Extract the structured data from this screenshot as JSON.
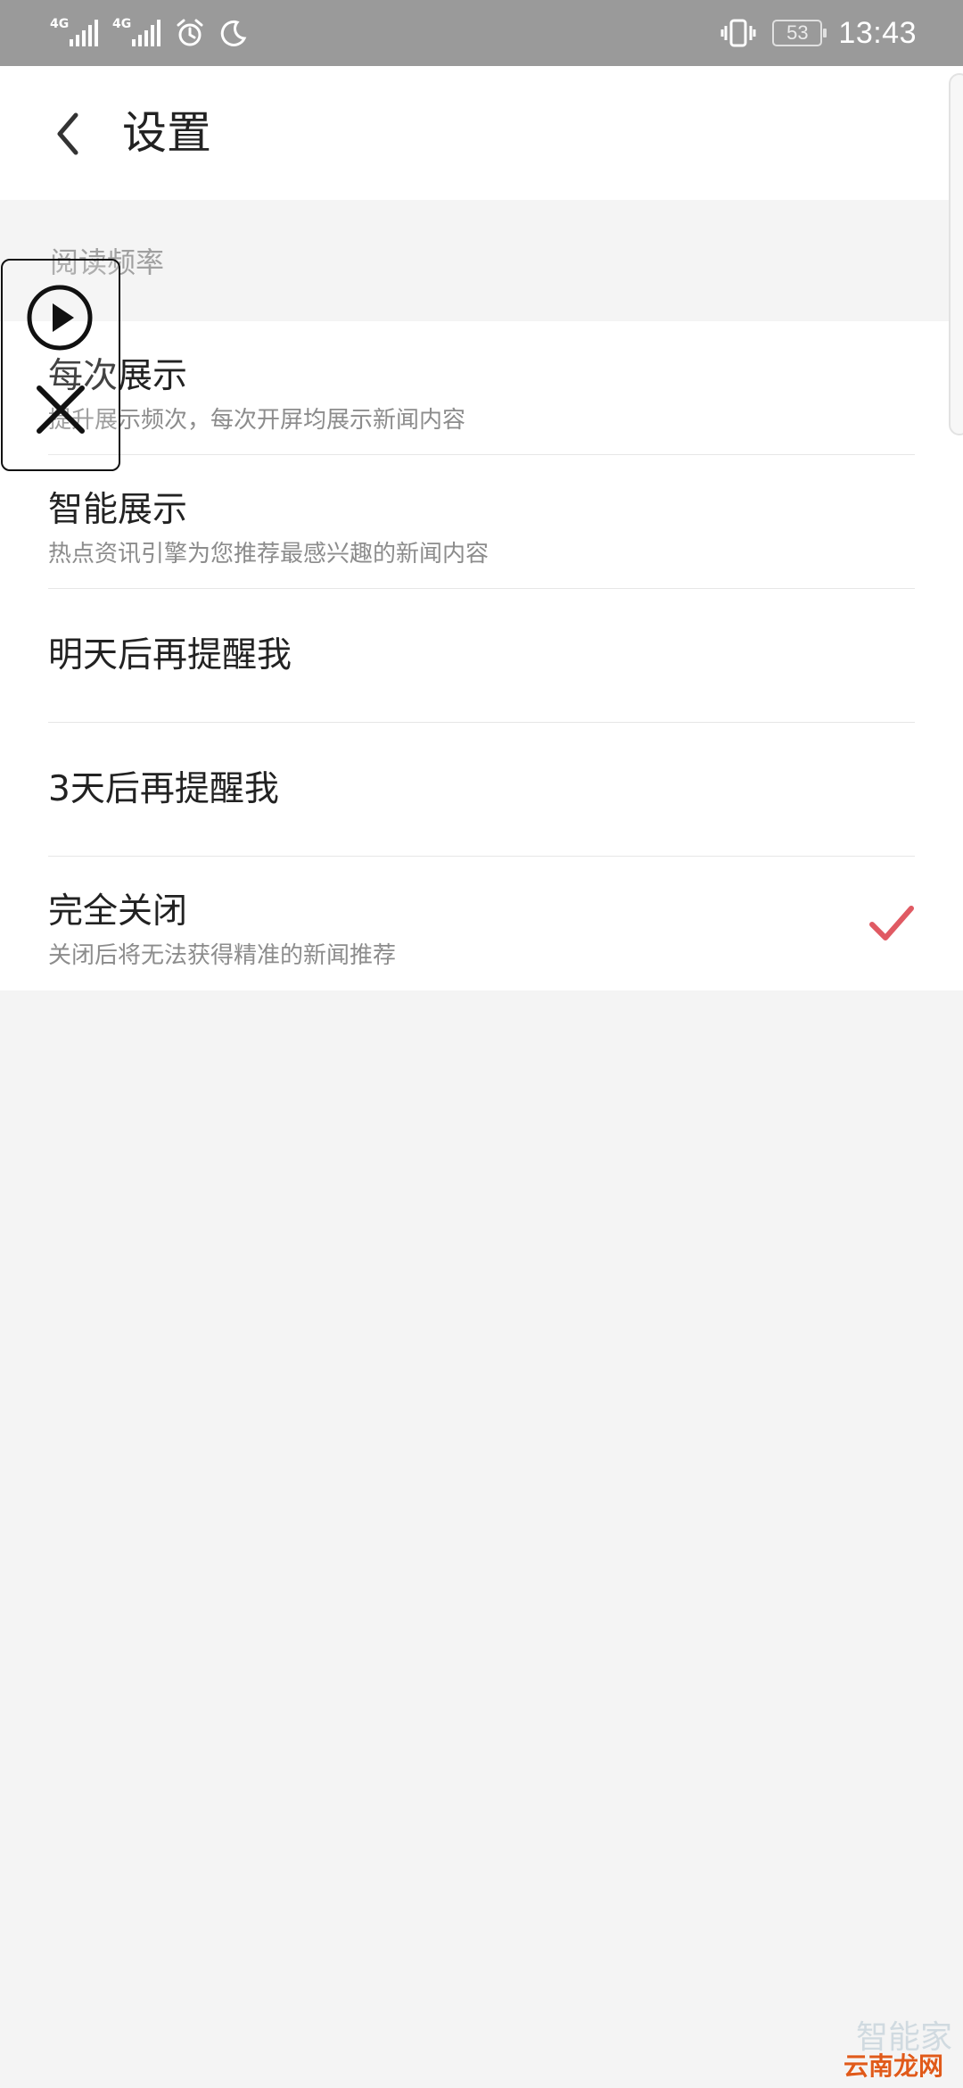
{
  "status_bar": {
    "network_1": "4G",
    "network_2": "4G",
    "battery": "53",
    "time": "13:43",
    "icons": [
      "signal-icon",
      "signal-icon",
      "alarm-icon",
      "moon-icon",
      "vibrate-icon",
      "battery-icon"
    ]
  },
  "header": {
    "title": "设置",
    "back_icon": "chevron-left-icon"
  },
  "section": {
    "title": "阅读频率"
  },
  "options": [
    {
      "title": "每次展示",
      "description": "提升展示频次，每次开屏均展示新闻内容",
      "selected": false
    },
    {
      "title": "智能展示",
      "description": "热点资讯引擎为您推荐最感兴趣的新闻内容",
      "selected": false
    },
    {
      "title": "明天后再提醒我",
      "selected": false
    },
    {
      "title": "3天后再提醒我",
      "selected": false
    },
    {
      "title": "完全关闭",
      "description": "关闭后将无法获得精准的新闻推荐",
      "selected": true
    }
  ],
  "colors": {
    "status_bar_bg": "#9a9a9a",
    "check_mark": "#e05a63",
    "page_bg": "#f4f4f4"
  },
  "watermark": {
    "top": "智能家",
    "bottom": "云南龙网"
  }
}
